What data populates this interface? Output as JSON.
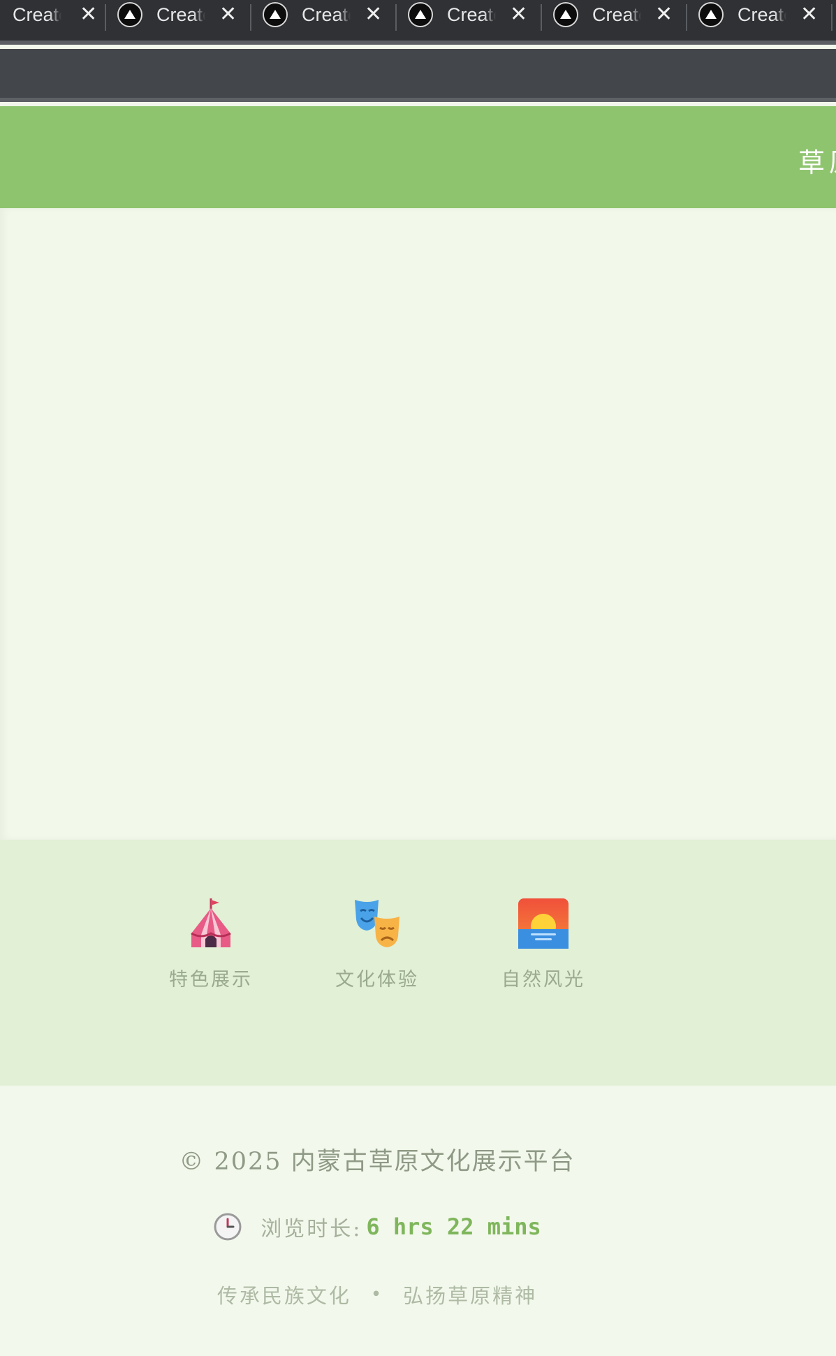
{
  "browser": {
    "tabs": [
      {
        "title": "Create"
      },
      {
        "title": "Create"
      },
      {
        "title": "Create"
      },
      {
        "title": "Create"
      },
      {
        "title": "Create"
      },
      {
        "title": "Create"
      }
    ],
    "close_glyph": "✕"
  },
  "header": {
    "title": "草原"
  },
  "quick_links": [
    {
      "label": "特色展示",
      "icon": "circus-tent-icon"
    },
    {
      "label": "文化体验",
      "icon": "theater-masks-icon"
    },
    {
      "label": "自然风光",
      "icon": "sunset-icon"
    }
  ],
  "footer": {
    "copyright": "© 2025 内蒙古草原文化展示平台",
    "duration_label": "浏览时长:",
    "duration_value": "6 hrs 22 mins",
    "slogan_left": "传承民族文化",
    "slogan_sep": "•",
    "slogan_right": "弘扬草原精神"
  },
  "colors": {
    "header_green": "#8fc46f",
    "accent_green": "#7fb65c",
    "page_bg": "#f3f8ec",
    "band_bg": "#e2f0d6"
  }
}
